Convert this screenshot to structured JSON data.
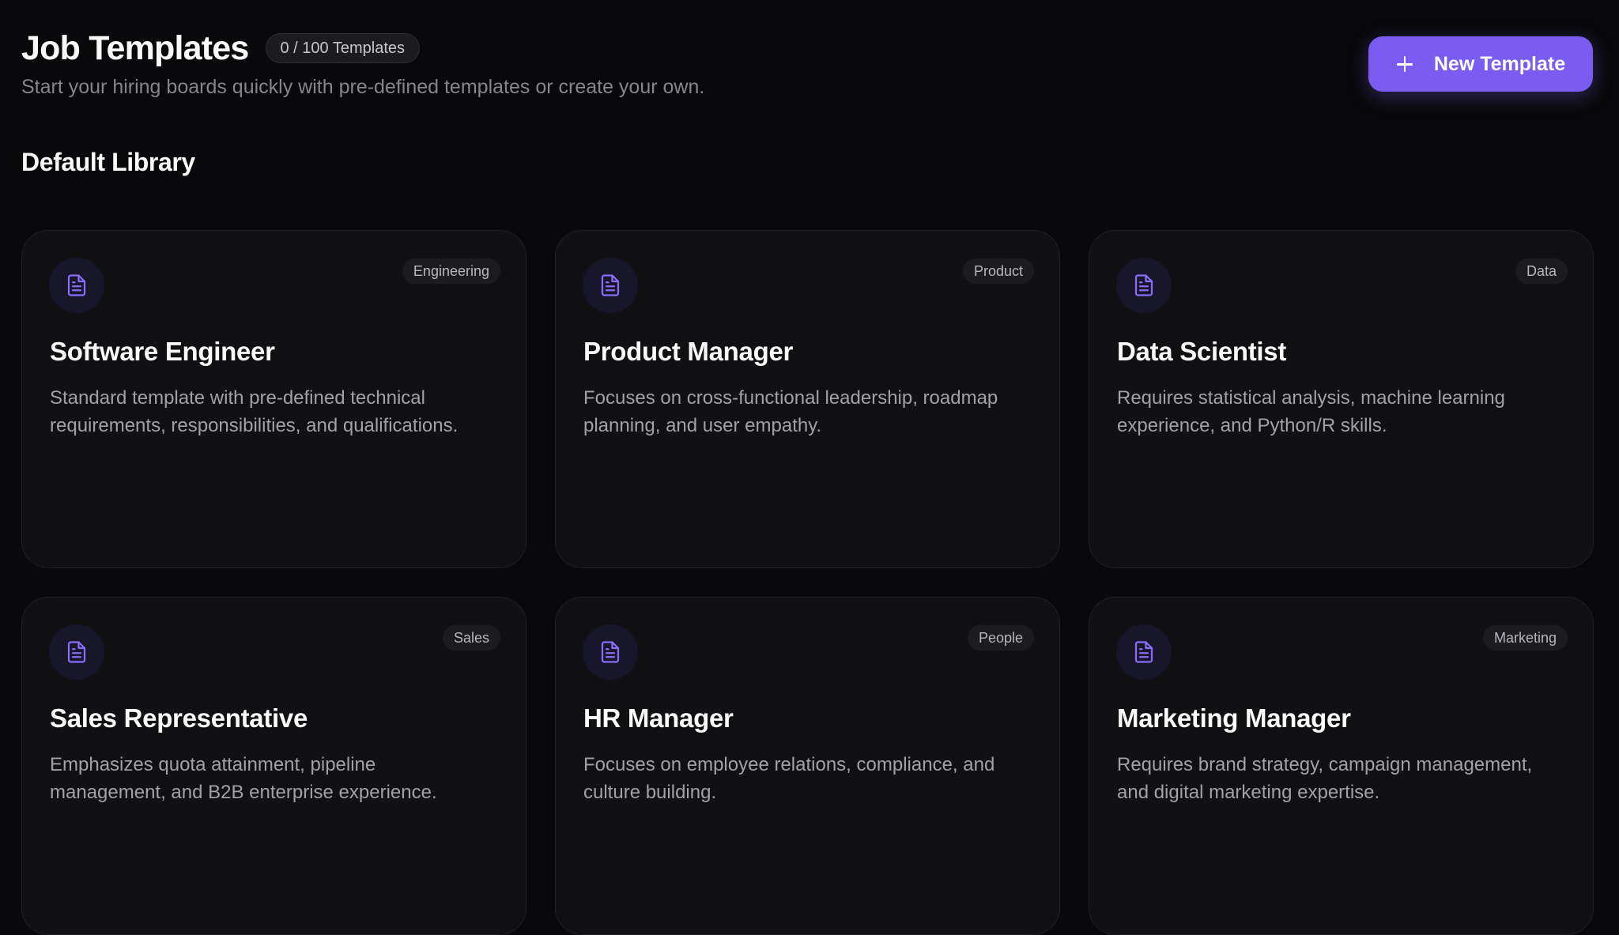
{
  "header": {
    "title": "Job Templates",
    "count_badge": "0 / 100 Templates",
    "subtitle": "Start your hiring boards quickly with pre-defined templates or create your own.",
    "new_button_label": "New Template"
  },
  "section": {
    "title": "Default Library"
  },
  "colors": {
    "accent": "#7b5cf2",
    "background": "#09090b",
    "card": "#111114",
    "icon": "#8b6cf6"
  },
  "templates": [
    {
      "icon": "document-icon",
      "category": "Engineering",
      "title": "Software Engineer",
      "description": "Standard template with pre-defined technical requirements, responsibilities, and qualifications."
    },
    {
      "icon": "document-icon",
      "category": "Product",
      "title": "Product Manager",
      "description": "Focuses on cross-functional leadership, roadmap planning, and user empathy."
    },
    {
      "icon": "document-icon",
      "category": "Data",
      "title": "Data Scientist",
      "description": "Requires statistical analysis, machine learning experience, and Python/R skills."
    },
    {
      "icon": "document-icon",
      "category": "Sales",
      "title": "Sales Representative",
      "description": "Emphasizes quota attainment, pipeline management, and B2B enterprise experience."
    },
    {
      "icon": "document-icon",
      "category": "People",
      "title": "HR Manager",
      "description": "Focuses on employee relations, compliance, and culture building."
    },
    {
      "icon": "document-icon",
      "category": "Marketing",
      "title": "Marketing Manager",
      "description": "Requires brand strategy, campaign management, and digital marketing expertise."
    }
  ]
}
